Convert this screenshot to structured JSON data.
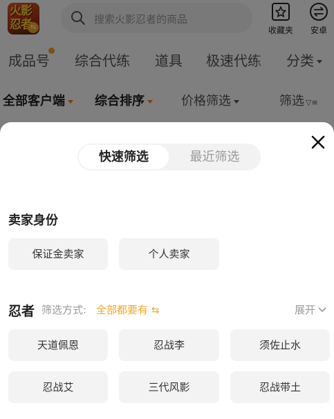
{
  "topbar": {
    "logo_line1": "火影",
    "logo_line2": "忍者",
    "search_placeholder": "搜索火影忍者的商品",
    "favorites_label": "收藏夹",
    "platform_label": "安卓"
  },
  "category_tabs": [
    "成品号",
    "综合代练",
    "道具",
    "极速代练",
    "分类"
  ],
  "filter_bar": {
    "client": "全部客户端",
    "sort": "综合排序",
    "price": "价格筛选",
    "filter": "筛选"
  },
  "sheet": {
    "seg_quick": "快速筛选",
    "seg_recent": "最近筛选",
    "seller_title": "卖家身份",
    "seller_options": [
      "保证金卖家",
      "个人卖家"
    ],
    "ninja_title": "忍者",
    "mode_label": "筛选方式:",
    "mode_value": "全部都要有",
    "expand_label": "展开",
    "ninja_options": [
      "天道佩恩",
      "忍战李",
      "须佐止水",
      "忍战艾",
      "三代风影",
      "忍战带土"
    ]
  },
  "colors": {
    "accent": "#f5a623",
    "overlay": "rgba(0,0,0,0.5)"
  }
}
